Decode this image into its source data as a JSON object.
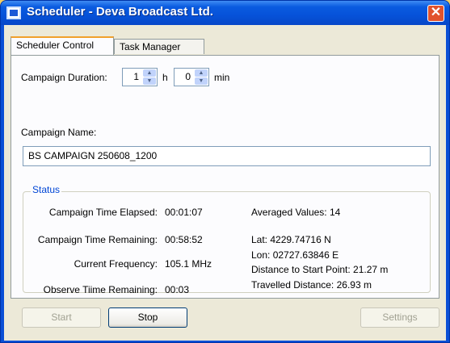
{
  "window": {
    "title": "Scheduler - Deva Broadcast Ltd.",
    "close_glyph": "✕"
  },
  "tabs": [
    {
      "label": "Scheduler Control",
      "active": true
    },
    {
      "label": "Task Manager",
      "active": false
    }
  ],
  "duration": {
    "label": "Campaign Duration:",
    "hours_value": "1",
    "hours_unit": "h",
    "minutes_value": "0",
    "minutes_unit": "min"
  },
  "campaign_name": {
    "label": "Campaign Name:",
    "value": "BS CAMPAIGN 250608_1200"
  },
  "status": {
    "title": "Status",
    "time_elapsed_label": "Campaign Time Elapsed:",
    "time_elapsed_value": "00:01:07",
    "time_remaining_label": "Campaign Time Remaining:",
    "time_remaining_value": "00:58:52",
    "frequency_label": "Current Frequency:",
    "frequency_value": "105.1 MHz",
    "observe_label": "Observe Tiime Remaining:",
    "observe_value": "00:03",
    "averaged": "Averaged Values: 14",
    "lat": "Lat:  4229.74716 N",
    "lon": "Lon:  02727.63846 E",
    "distance_start": "Distance to Start Point: 21.27 m",
    "travelled": "Travelled Distance:  26.93 m"
  },
  "buttons": {
    "start": "Start",
    "stop": "Stop",
    "settings": "Settings"
  },
  "colors": {
    "titlebar": "#0a5be0",
    "close": "#e1532d",
    "group_title": "#0046d5",
    "dialog_bg": "#ece9d8"
  },
  "icons": {
    "app": "window-app-icon",
    "close": "close-icon",
    "spin_up": "spin-up-icon",
    "spin_down": "spin-down-icon"
  }
}
